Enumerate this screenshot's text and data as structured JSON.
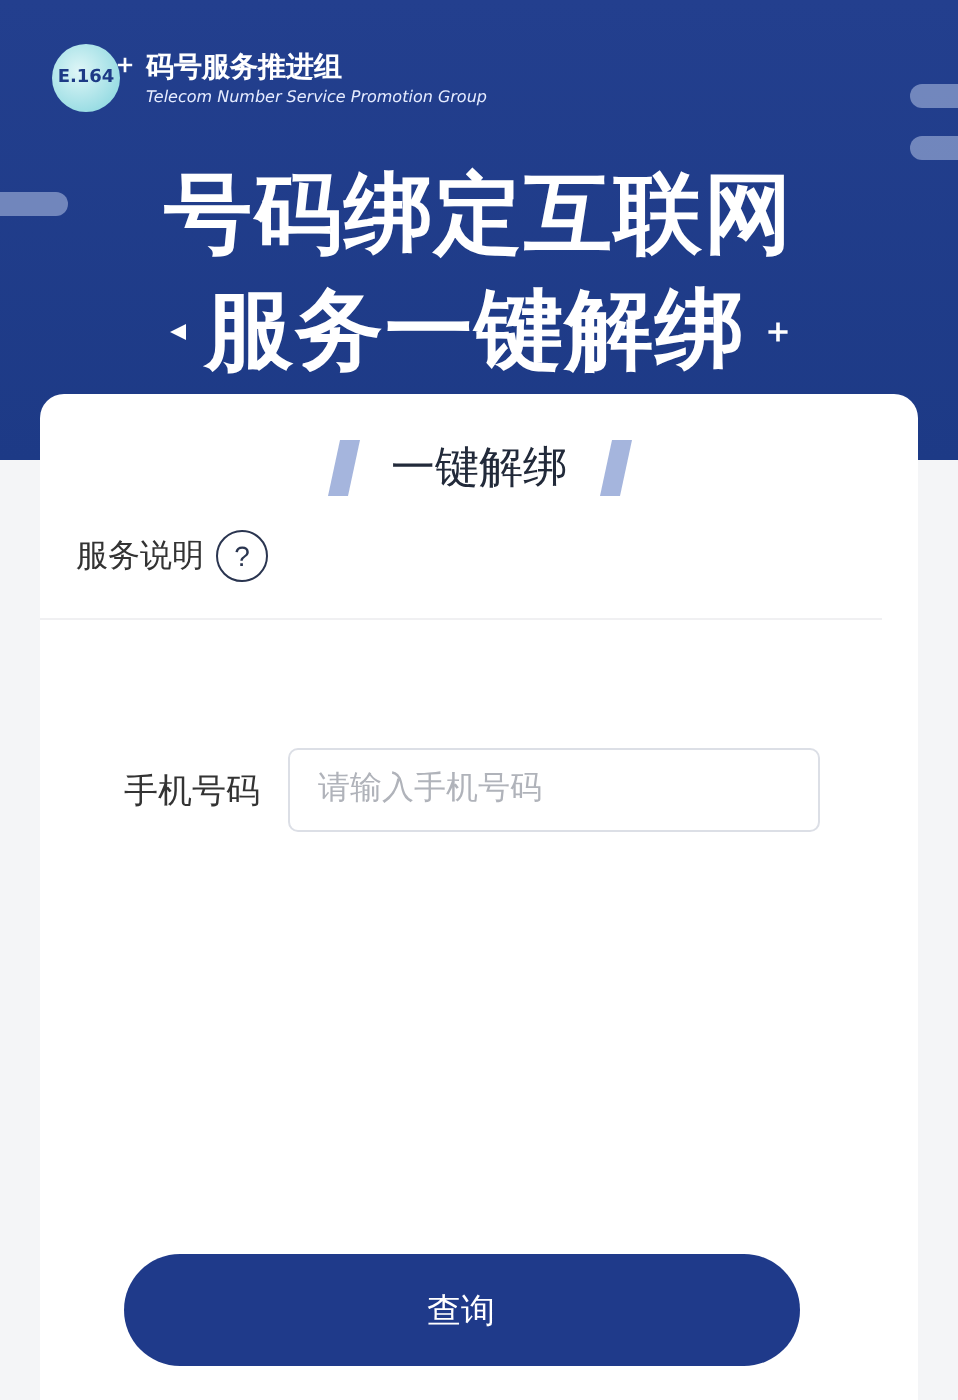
{
  "header": {
    "logo_text": "E.164",
    "org_name": "码号服务推进组",
    "org_name_en": "Telecom Number Service  Promotion Group",
    "headline": [
      "号码绑定互联网",
      "服务一键解绑"
    ]
  },
  "card": {
    "title": "一键解绑",
    "info_label": "服务说明",
    "info_icon": "?",
    "phone_label": "手机号码",
    "phone_field": {
      "placeholder": "请输入手机号码"
    }
  },
  "button": "查询"
}
